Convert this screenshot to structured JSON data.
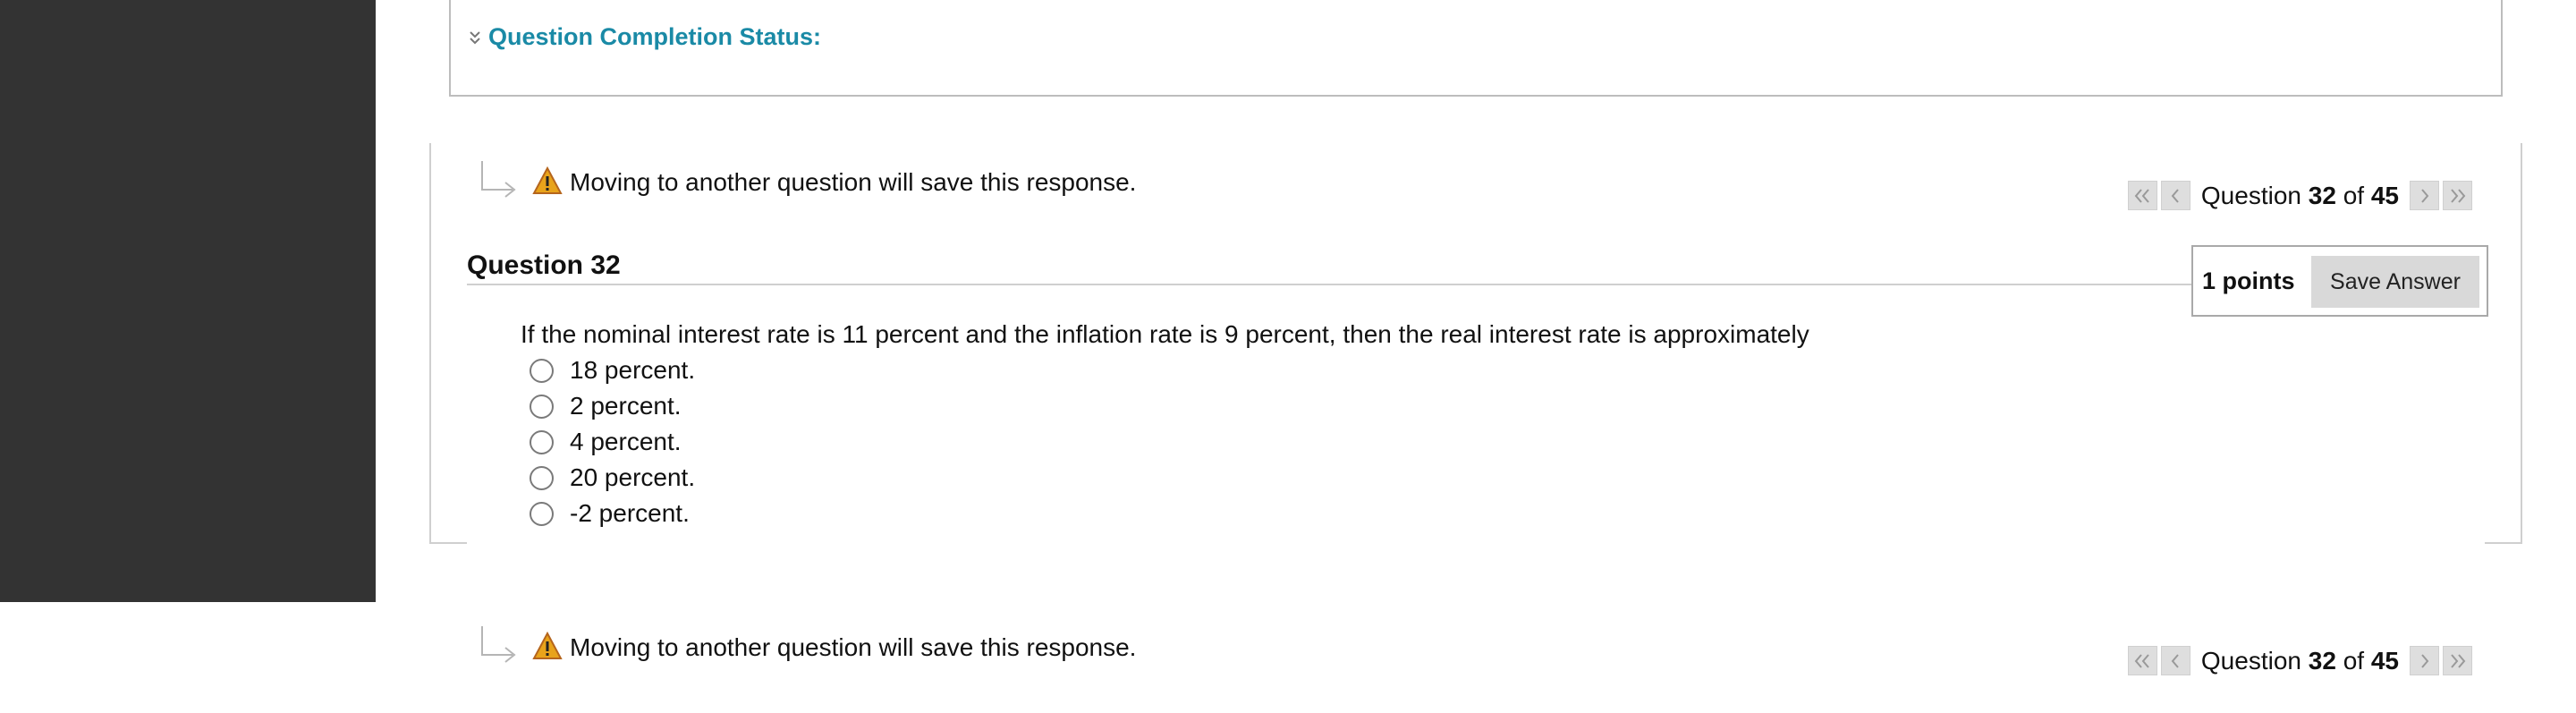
{
  "status": {
    "label": "Question Completion Status:"
  },
  "save_notice": {
    "top_text": "Moving to another question will save this response.",
    "bottom_text": "Moving to another question will save this response."
  },
  "pager": {
    "word": "Question",
    "current": "32",
    "of_word": "of",
    "total": "45"
  },
  "question": {
    "title": "Question 32",
    "points": "1 points",
    "save_label": "Save Answer",
    "text": "If the nominal interest rate is 11 percent and the inflation rate is 9 percent, then the real interest rate is approximately",
    "options": [
      "18 percent.",
      "2 percent.",
      "4 percent.",
      "20 percent.",
      "-2 percent."
    ]
  },
  "colors": {
    "sidebar": "#333333",
    "link": "#1a8aa6",
    "warning": "#e8a31b"
  }
}
